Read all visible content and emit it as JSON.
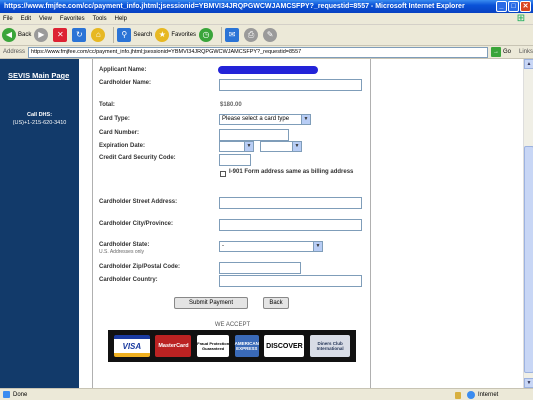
{
  "window": {
    "title": "https://www.fmjfee.com/cc/payment_info.jhtml;jsessionid=YBMVI34JRQPGWCWJAMCSFPY?_requestid=8557 - Microsoft Internet Explorer",
    "min": "_",
    "max": "□",
    "close": "✕"
  },
  "menu": [
    "File",
    "Edit",
    "View",
    "Favorites",
    "Tools",
    "Help"
  ],
  "toolbar": {
    "back": "Back",
    "search": "Search",
    "favorites": "Favorites"
  },
  "address": {
    "label": "Address",
    "url": "https://www.fmjfee.com/cc/payment_info.jhtml;jsessionid=YBMVI34JRQPGWCWJAMCSFPY?_requestid=8557",
    "go": "Go",
    "links": "Links"
  },
  "sidebar": {
    "main_link": "SEVIS Main Page",
    "call_title": "Call DHS:",
    "call_number": "(US)+1-215-620-3410"
  },
  "form": {
    "applicant_name_label": "Applicant Name:",
    "cardholder_name_label": "Cardholder Name:",
    "total_label": "Total:",
    "total_value": "$180.00",
    "card_type_label": "Card Type:",
    "card_type_value": "Please select a card type",
    "card_number_label": "Card Number:",
    "expiration_label": "Expiration Date:",
    "security_code_label": "Credit Card Security Code:",
    "same_address_label": "I-901 Form address same as billing address",
    "street_label": "Cardholder Street Address:",
    "city_label": "Cardholder City/Province:",
    "state_label": "Cardholder State:",
    "state_note": "U.S. Addresses only",
    "state_value": "-",
    "zip_label": "Cardholder Zip/Postal Code:",
    "country_label": "Cardholder Country:",
    "submit": "Submit Payment",
    "back": "Back"
  },
  "payment": {
    "we_accept": "WE ACCEPT",
    "cards": [
      "VISA",
      "MasterCard",
      "Fraud Protection Guaranteed",
      "AMERICAN EXPRESS",
      "DISCOVER",
      "Diners Club International"
    ]
  },
  "status": {
    "left": "Done",
    "zone": "Internet"
  }
}
